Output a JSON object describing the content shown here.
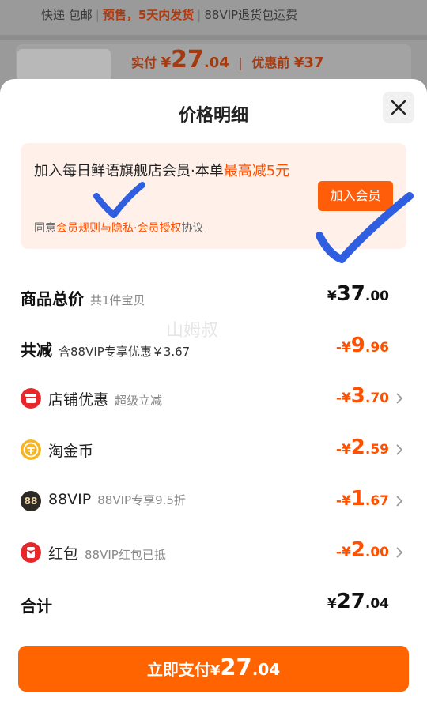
{
  "background": {
    "shipping": "快递 包邮",
    "presale": "预售，5天内发货",
    "vip_note": "88VIP退货包运费",
    "paid_label": "实付",
    "paid_currency": "¥",
    "paid_int": "27",
    "paid_dec": ".04",
    "before_label": "优惠前",
    "before_value": "¥37"
  },
  "sheet": {
    "title": "价格明细",
    "close_icon": "close-icon"
  },
  "promo": {
    "text_main": "加入每日鲜语旗舰店会员·本单",
    "text_highlight": "最高减5元",
    "agree_prefix": "同意",
    "agree_link": "会员规则与隐私·会员授权",
    "agree_suffix": "协议",
    "join_button": "加入会员"
  },
  "rows": {
    "total": {
      "label": "商品总价",
      "sub": "共1件宝贝",
      "currency": "¥",
      "int": "37",
      "dec": ".00"
    },
    "reduce": {
      "label": "共减",
      "sub": "含88VIP专享优惠￥3.67",
      "currency": "-¥",
      "int": "9",
      "dec": ".96"
    },
    "shop": {
      "label": "店铺优惠",
      "sub": "超级立减",
      "currency": "-¥",
      "int": "3",
      "dec": ".70"
    },
    "coin": {
      "label": "淘金币",
      "currency": "-¥",
      "int": "2",
      "dec": ".59"
    },
    "vip": {
      "label": "88VIP",
      "sub": "88VIP专享9.5折",
      "icon_text": "88",
      "currency": "-¥",
      "int": "1",
      "dec": ".67"
    },
    "redpack": {
      "label": "红包",
      "sub": "88VIP红包已抵",
      "currency": "-¥",
      "int": "2",
      "dec": ".00"
    },
    "sum": {
      "label": "合计",
      "currency": "¥",
      "int": "27",
      "dec": ".04"
    }
  },
  "watermark": "山姆叔",
  "pay_button": {
    "label": "立即支付",
    "currency": "¥",
    "int": "27",
    "dec": ".04"
  },
  "colors": {
    "accent": "#ff5000",
    "pay": "#ff6400",
    "promo_bg": "#fff1ea",
    "check": "#2f5fe0"
  }
}
